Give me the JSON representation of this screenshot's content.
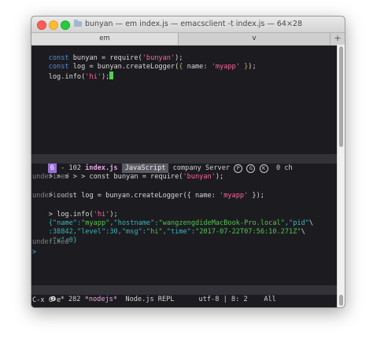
{
  "window": {
    "title": "bunyan — em index.js — emacsclient -t index.js — 64×28",
    "tabs": [
      {
        "label": "em",
        "active": true
      },
      {
        "label": "v",
        "active": false
      }
    ],
    "add_tab_label": "+"
  },
  "editor": {
    "line1": {
      "kw": "const",
      "rest1": " bunyan = require(",
      "str": "'bunyan'",
      "rest2": ");"
    },
    "line2": {
      "kw": "const",
      "rest1": " log = bunyan.createLogger(",
      "brace1": "{",
      "rest2": " name: ",
      "str": "'myapp'",
      "brace2": "}",
      "rest3": ");"
    },
    "line3": {
      "text1": "log.info(",
      "str": "'hi'",
      "text2": ");"
    }
  },
  "modeline_top": {
    "badge": "6",
    "indicator": " - 102 ",
    "file": "index.js",
    "lang": "JavaScript",
    "minor": " company Server ",
    "icons": [
      "P",
      "G",
      "K"
    ],
    "position": "  0 ch"
  },
  "repl": {
    "l1": {
      "prompt": "> > > > > ",
      "code": "const bunyan = require(",
      "str": "'bunyan'",
      "end": ");"
    },
    "l2": "undefined",
    "l3": {
      "prompt": "> ",
      "code": "const log = bunyan.createLogger({ name: ",
      "str": "'myapp'",
      "end": " });"
    },
    "l4": "undefined",
    "l5": {
      "prompt": "> ",
      "code": "log.info(",
      "str": "'hi'",
      "end": ");"
    },
    "json1": {
      "a": "{",
      "k1": "\"name\"",
      "b": ":",
      "v1": "\"myapp\"",
      "c": ",",
      "k2": "\"hostname\"",
      "d": ":",
      "v2": "\"wangzengdideMacBook-Pro.local\"",
      "e": ",",
      "k3": "\"pid\"",
      "f": "\\"
    },
    "json2": {
      "a": ":38842,",
      "k1": "\"level\"",
      "b": ":30,",
      "k2": "\"msg\"",
      "c": ":",
      "v1": "\"hi\"",
      "d": ",",
      "k3": "\"time\"",
      "e": ":",
      "v2": "\"2017-07-22T07:56:10.271Z\"",
      "f": "\\"
    },
    "json3": {
      "a": ",",
      "k1": "\"v\"",
      "b": ":0}"
    },
    "l9": "undefined",
    "prompt_final": ">"
  },
  "modeline_bottom": {
    "badge": "❷",
    "indicator": " * 282 ",
    "buffer": "*nodejs*",
    "mode": "  Node.js REPL      ",
    "encoding": "utf-8",
    "position": " | 8: 2    All"
  },
  "minibuffer": "C-x C-e",
  "colors": {
    "background": "#1c1c20",
    "keyword": "#4e8fd9",
    "string": "#ff5f9e",
    "cursor": "#4fd44f",
    "modeline": "#323238",
    "badge": "#9b6fd6"
  }
}
